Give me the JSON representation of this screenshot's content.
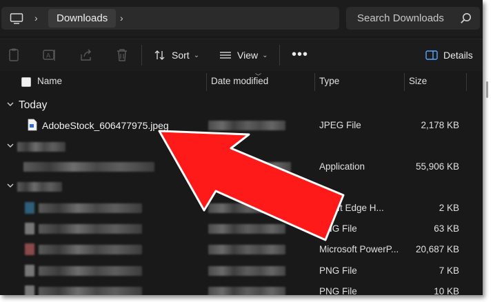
{
  "address": {
    "crumbs": [
      "Downloads"
    ]
  },
  "search": {
    "placeholder": "Search Downloads"
  },
  "toolbar": {
    "sort_label": "Sort",
    "view_label": "View",
    "more_label": "•••",
    "details_label": "Details"
  },
  "columns": {
    "name": "Name",
    "date": "Date modified",
    "type": "Type",
    "size": "Size"
  },
  "groups": {
    "today": "Today"
  },
  "files": [
    {
      "name": "AdobeStock_606477975.jpeg",
      "type": "JPEG File",
      "size": "2,178 KB"
    },
    {
      "name": "",
      "type": "Application",
      "size": "55,906 KB"
    },
    {
      "name": "",
      "type": "rosoft Edge H...",
      "size": "2 KB"
    },
    {
      "name": "",
      "type": "PNG File",
      "size": "63 KB"
    },
    {
      "name": "",
      "type": "Microsoft PowerP...",
      "size": "20,687 KB"
    },
    {
      "name": "",
      "type": "PNG File",
      "size": "7 KB"
    },
    {
      "name": "",
      "type": "PNG File",
      "size": "10 KB"
    }
  ],
  "colors": {
    "background": "#191919",
    "annotation_arrow": "#ff1a1a",
    "jpeg_icon_accent": "#2d6fd6"
  }
}
